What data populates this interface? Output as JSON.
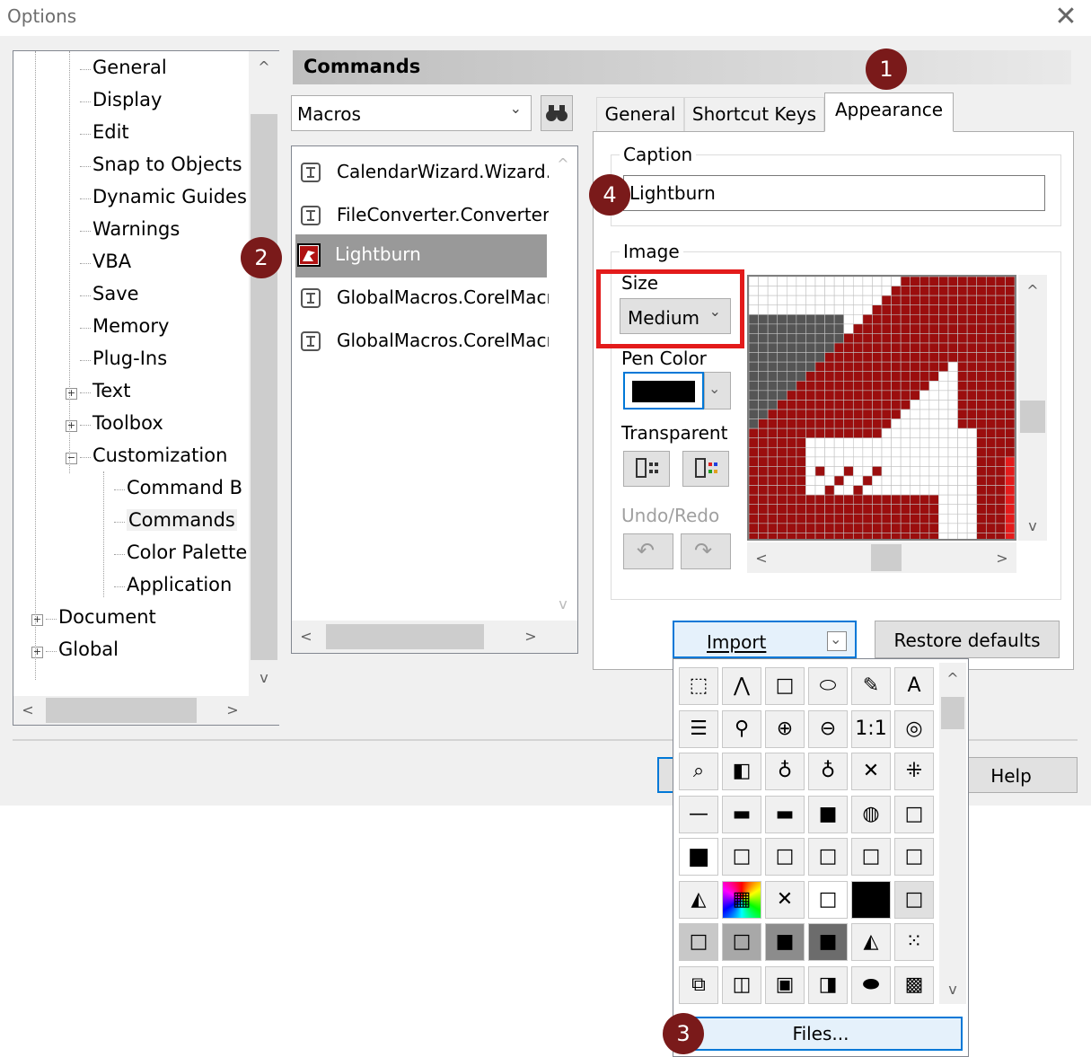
{
  "window": {
    "title": "Options",
    "close_glyph": "✕"
  },
  "tree": {
    "items": [
      {
        "label": "General",
        "level": 2
      },
      {
        "label": "Display",
        "level": 2
      },
      {
        "label": "Edit",
        "level": 2
      },
      {
        "label": "Snap to Objects",
        "level": 2
      },
      {
        "label": "Dynamic Guides",
        "level": 2
      },
      {
        "label": "Warnings",
        "level": 2
      },
      {
        "label": "VBA",
        "level": 2
      },
      {
        "label": "Save",
        "level": 2
      },
      {
        "label": "Memory",
        "level": 2
      },
      {
        "label": "Plug-Ins",
        "level": 2
      },
      {
        "label": "Text",
        "level": 2,
        "expander": "+"
      },
      {
        "label": "Toolbox",
        "level": 2,
        "expander": "+"
      },
      {
        "label": "Customization",
        "level": 2,
        "expander": "−"
      },
      {
        "label": "Command B",
        "level": 3
      },
      {
        "label": "Commands",
        "level": 3,
        "selected": true
      },
      {
        "label": "Color Palette",
        "level": 3
      },
      {
        "label": "Application",
        "level": 3
      },
      {
        "label": "Document",
        "level": 1,
        "expander": "+"
      },
      {
        "label": "Global",
        "level": 1,
        "expander": "+"
      }
    ]
  },
  "commands": {
    "header": "Commands",
    "category_value": "Macros",
    "list": [
      {
        "label": "CalendarWizard.Wizard."
      },
      {
        "label": "FileConverter.Converter"
      },
      {
        "label": "Lightburn",
        "selected": true
      },
      {
        "label": "GlobalMacros.CorelMacr"
      },
      {
        "label": "GlobalMacros.CorelMacr"
      }
    ]
  },
  "tabs": [
    {
      "label": "General"
    },
    {
      "label": "Shortcut Keys"
    },
    {
      "label": "Appearance",
      "active": true
    }
  ],
  "appearance": {
    "caption_label": "Caption",
    "caption_value": "Lightburn",
    "image_label": "Image",
    "size_label": "Size",
    "size_value": "Medium",
    "pen_color_label": "Pen Color",
    "pen_color_value": "#000000",
    "transparent_label": "Transparent",
    "undo_redo_label": "Undo/Redo",
    "import_label": "Import",
    "restore_label": "Restore defaults"
  },
  "footer": {
    "help_label": "Help"
  },
  "palette": {
    "files_label": "Files..."
  },
  "badges": [
    "1",
    "2",
    "3",
    "4"
  ],
  "colors": {
    "accent": "#0078d7",
    "badge": "#7a1a1a",
    "highlight_red": "#e31b1b",
    "pixel_dark": "#9b0e0e"
  }
}
